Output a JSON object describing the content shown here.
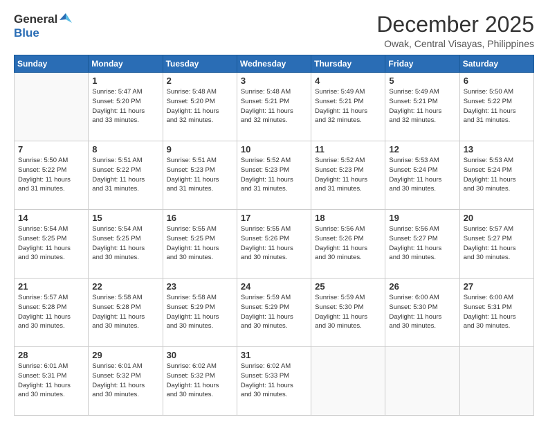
{
  "header": {
    "logo_line1": "General",
    "logo_line2": "Blue",
    "month": "December 2025",
    "location": "Owak, Central Visayas, Philippines"
  },
  "days_of_week": [
    "Sunday",
    "Monday",
    "Tuesday",
    "Wednesday",
    "Thursday",
    "Friday",
    "Saturday"
  ],
  "weeks": [
    [
      {
        "day": "",
        "info": ""
      },
      {
        "day": "1",
        "info": "Sunrise: 5:47 AM\nSunset: 5:20 PM\nDaylight: 11 hours\nand 33 minutes."
      },
      {
        "day": "2",
        "info": "Sunrise: 5:48 AM\nSunset: 5:20 PM\nDaylight: 11 hours\nand 32 minutes."
      },
      {
        "day": "3",
        "info": "Sunrise: 5:48 AM\nSunset: 5:21 PM\nDaylight: 11 hours\nand 32 minutes."
      },
      {
        "day": "4",
        "info": "Sunrise: 5:49 AM\nSunset: 5:21 PM\nDaylight: 11 hours\nand 32 minutes."
      },
      {
        "day": "5",
        "info": "Sunrise: 5:49 AM\nSunset: 5:21 PM\nDaylight: 11 hours\nand 32 minutes."
      },
      {
        "day": "6",
        "info": "Sunrise: 5:50 AM\nSunset: 5:22 PM\nDaylight: 11 hours\nand 31 minutes."
      }
    ],
    [
      {
        "day": "7",
        "info": "Sunrise: 5:50 AM\nSunset: 5:22 PM\nDaylight: 11 hours\nand 31 minutes."
      },
      {
        "day": "8",
        "info": "Sunrise: 5:51 AM\nSunset: 5:22 PM\nDaylight: 11 hours\nand 31 minutes."
      },
      {
        "day": "9",
        "info": "Sunrise: 5:51 AM\nSunset: 5:23 PM\nDaylight: 11 hours\nand 31 minutes."
      },
      {
        "day": "10",
        "info": "Sunrise: 5:52 AM\nSunset: 5:23 PM\nDaylight: 11 hours\nand 31 minutes."
      },
      {
        "day": "11",
        "info": "Sunrise: 5:52 AM\nSunset: 5:23 PM\nDaylight: 11 hours\nand 31 minutes."
      },
      {
        "day": "12",
        "info": "Sunrise: 5:53 AM\nSunset: 5:24 PM\nDaylight: 11 hours\nand 30 minutes."
      },
      {
        "day": "13",
        "info": "Sunrise: 5:53 AM\nSunset: 5:24 PM\nDaylight: 11 hours\nand 30 minutes."
      }
    ],
    [
      {
        "day": "14",
        "info": "Sunrise: 5:54 AM\nSunset: 5:25 PM\nDaylight: 11 hours\nand 30 minutes."
      },
      {
        "day": "15",
        "info": "Sunrise: 5:54 AM\nSunset: 5:25 PM\nDaylight: 11 hours\nand 30 minutes."
      },
      {
        "day": "16",
        "info": "Sunrise: 5:55 AM\nSunset: 5:25 PM\nDaylight: 11 hours\nand 30 minutes."
      },
      {
        "day": "17",
        "info": "Sunrise: 5:55 AM\nSunset: 5:26 PM\nDaylight: 11 hours\nand 30 minutes."
      },
      {
        "day": "18",
        "info": "Sunrise: 5:56 AM\nSunset: 5:26 PM\nDaylight: 11 hours\nand 30 minutes."
      },
      {
        "day": "19",
        "info": "Sunrise: 5:56 AM\nSunset: 5:27 PM\nDaylight: 11 hours\nand 30 minutes."
      },
      {
        "day": "20",
        "info": "Sunrise: 5:57 AM\nSunset: 5:27 PM\nDaylight: 11 hours\nand 30 minutes."
      }
    ],
    [
      {
        "day": "21",
        "info": "Sunrise: 5:57 AM\nSunset: 5:28 PM\nDaylight: 11 hours\nand 30 minutes."
      },
      {
        "day": "22",
        "info": "Sunrise: 5:58 AM\nSunset: 5:28 PM\nDaylight: 11 hours\nand 30 minutes."
      },
      {
        "day": "23",
        "info": "Sunrise: 5:58 AM\nSunset: 5:29 PM\nDaylight: 11 hours\nand 30 minutes."
      },
      {
        "day": "24",
        "info": "Sunrise: 5:59 AM\nSunset: 5:29 PM\nDaylight: 11 hours\nand 30 minutes."
      },
      {
        "day": "25",
        "info": "Sunrise: 5:59 AM\nSunset: 5:30 PM\nDaylight: 11 hours\nand 30 minutes."
      },
      {
        "day": "26",
        "info": "Sunrise: 6:00 AM\nSunset: 5:30 PM\nDaylight: 11 hours\nand 30 minutes."
      },
      {
        "day": "27",
        "info": "Sunrise: 6:00 AM\nSunset: 5:31 PM\nDaylight: 11 hours\nand 30 minutes."
      }
    ],
    [
      {
        "day": "28",
        "info": "Sunrise: 6:01 AM\nSunset: 5:31 PM\nDaylight: 11 hours\nand 30 minutes."
      },
      {
        "day": "29",
        "info": "Sunrise: 6:01 AM\nSunset: 5:32 PM\nDaylight: 11 hours\nand 30 minutes."
      },
      {
        "day": "30",
        "info": "Sunrise: 6:02 AM\nSunset: 5:32 PM\nDaylight: 11 hours\nand 30 minutes."
      },
      {
        "day": "31",
        "info": "Sunrise: 6:02 AM\nSunset: 5:33 PM\nDaylight: 11 hours\nand 30 minutes."
      },
      {
        "day": "",
        "info": ""
      },
      {
        "day": "",
        "info": ""
      },
      {
        "day": "",
        "info": ""
      }
    ]
  ]
}
